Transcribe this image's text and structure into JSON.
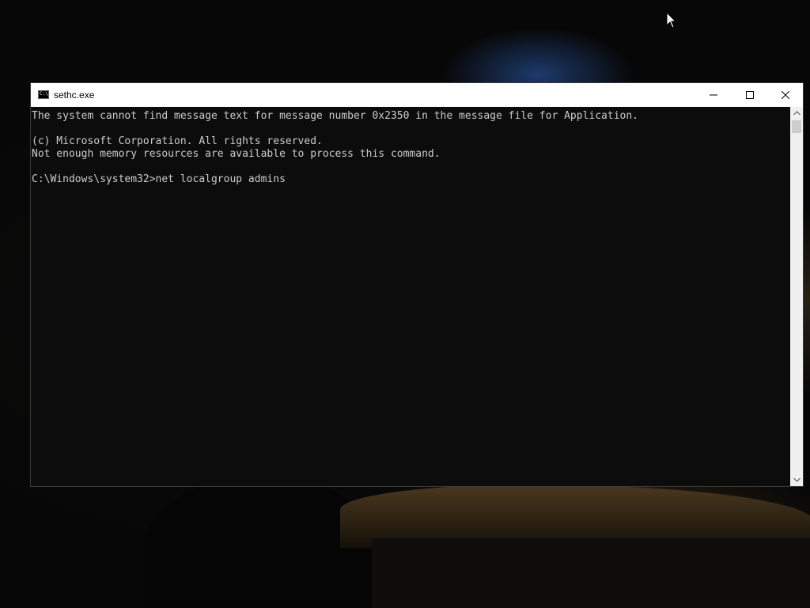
{
  "window": {
    "title": "sethc.exe",
    "icon": "command-prompt-icon",
    "prompt_glyph": "C:\\"
  },
  "console": {
    "lines": [
      "The system cannot find message text for message number 0x2350 in the message file for Application.",
      "",
      "(c) Microsoft Corporation. All rights reserved.",
      "Not enough memory resources are available to process this command.",
      "",
      "C:\\Windows\\system32>net localgroup admins"
    ],
    "text_color": "#cccccc",
    "background_color": "#0c0c0c"
  },
  "controls": {
    "minimize_icon": "minimize-icon",
    "maximize_icon": "maximize-icon",
    "close_icon": "close-icon"
  },
  "scrollbar": {
    "up_icon": "scroll-up-arrow-icon",
    "down_icon": "scroll-down-arrow-icon"
  },
  "colors": {
    "titlebar": "#ffffff",
    "desktop": "#0a0a0a"
  }
}
